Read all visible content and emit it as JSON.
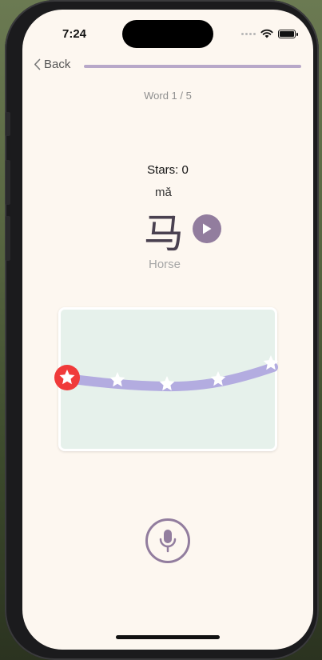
{
  "status_bar": {
    "time": "7:24"
  },
  "nav": {
    "back_label": "Back",
    "progress": 1.0
  },
  "lesson": {
    "word_counter": "Word 1 / 5",
    "stars_label": "Stars: 0",
    "pinyin": "mǎ",
    "character": "马",
    "meaning": "Horse"
  },
  "colors": {
    "accent": "#927d9e",
    "trace_path": "#b3ace0",
    "active_star": "#f03a3a",
    "board_bg": "#e6f1eb",
    "screen_bg": "#fdf7f0"
  },
  "icons": {
    "back": "chevron-left-icon",
    "play": "play-icon",
    "mic": "microphone-icon",
    "star": "star-icon"
  }
}
